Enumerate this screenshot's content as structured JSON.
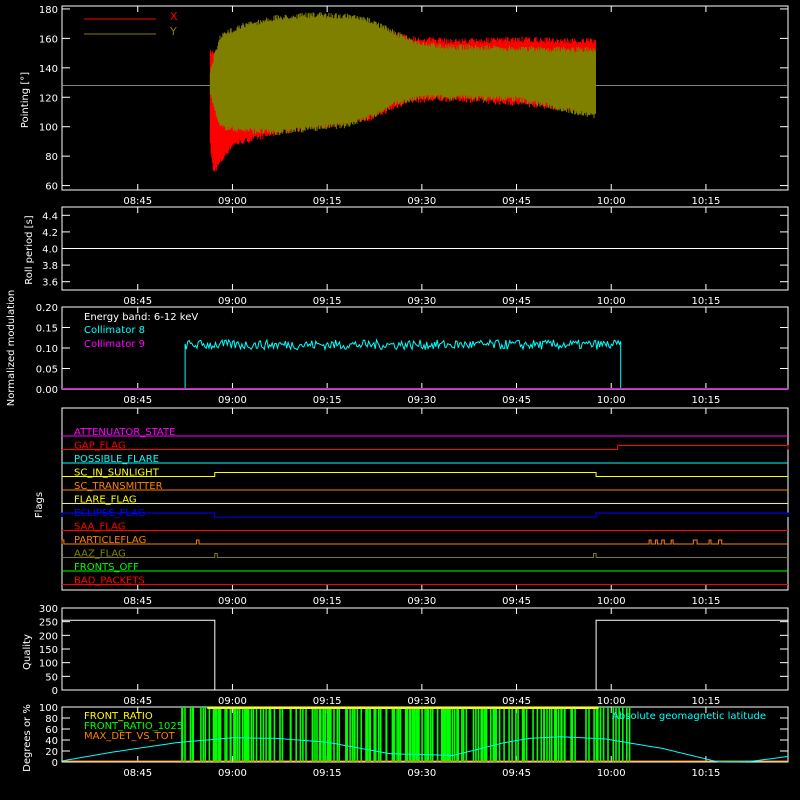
{
  "time_axis": {
    "tick_labels": [
      "08:45",
      "09:00",
      "09:15",
      "09:30",
      "09:45",
      "10:00",
      "10:15"
    ],
    "tick_minutes": [
      525,
      540,
      555,
      570,
      585,
      600,
      615
    ],
    "xlim_minutes": [
      513,
      628
    ]
  },
  "colors": {
    "axes": "#ffffff",
    "x_pointing": "#ff0000",
    "y_pointing": "#808000",
    "collimator_8": "#00ffff",
    "collimator_9": "#ff00ff",
    "front_ratio": "#ffff00",
    "front_ratio_1025": "#00ff00",
    "max_det_vs_tot": "#ff8000",
    "latitude": "#00ffff"
  },
  "chart_data": [
    {
      "type": "line",
      "ylabel": "Pointing [°]",
      "ylim": [
        57,
        182
      ],
      "yticks": [
        60,
        80,
        100,
        120,
        140,
        160,
        180
      ],
      "reference_line": 128,
      "series": [
        {
          "name": "X",
          "x_start": 536.5,
          "x_end": 597.5,
          "envelope_upper_x": [
            536.5,
            540,
            548,
            555,
            562,
            568,
            575,
            585,
            597.5
          ],
          "envelope_upper": [
            152,
            158,
            168,
            172,
            170,
            162,
            160,
            161,
            160
          ],
          "envelope_lower_x": [
            536.5,
            537,
            540,
            548,
            555,
            562,
            568,
            575,
            585,
            597.5
          ],
          "envelope_lower": [
            85,
            67,
            86,
            95,
            99,
            104,
            116,
            117,
            114,
            109
          ]
        },
        {
          "name": "Y",
          "x_start": 536.5,
          "x_end": 597.5,
          "envelope_upper_x": [
            536.5,
            538,
            541,
            547,
            553,
            558,
            562,
            566,
            570,
            575,
            585,
            597.5
          ],
          "envelope_upper": [
            140,
            163,
            170,
            176,
            178,
            177,
            174,
            165,
            158,
            156,
            155,
            154
          ],
          "envelope_lower_x": [
            536.5,
            538,
            541,
            547,
            553,
            558,
            562,
            566,
            570,
            575,
            585,
            597.5
          ],
          "envelope_lower": [
            120,
            98,
            96,
            94,
            97,
            99,
            105,
            114,
            118,
            118,
            117,
            105
          ]
        }
      ]
    },
    {
      "type": "line",
      "ylabel": "Roll period [s]",
      "ylim": [
        3.5,
        4.5
      ],
      "yticks": [
        3.6,
        3.8,
        4.0,
        4.2,
        4.4
      ],
      "series": [
        {
          "name": "",
          "x": [
            513,
            628
          ],
          "y": [
            4.0,
            4.0
          ]
        }
      ]
    },
    {
      "type": "line",
      "ylabel": "Normalized modulation",
      "ylim": [
        0,
        0.2
      ],
      "yticks": [
        0.0,
        0.05,
        0.1,
        0.15,
        0.2
      ],
      "annotation": "Energy band: 6-12 keV",
      "series": [
        {
          "name": "Collimator 8",
          "x_start": 532.5,
          "x_end": 601.5,
          "mean": 0.108,
          "spread": 0.012
        },
        {
          "name": "Collimator 9",
          "x": [
            513,
            628
          ],
          "y": [
            0.0,
            0.0
          ]
        }
      ]
    },
    {
      "type": "line",
      "ylabel": "Flags",
      "flags": [
        {
          "name": "ATTENUATOR_STATE",
          "color": "#ff00ff",
          "on": []
        },
        {
          "name": "GAP_FLAG",
          "color": "#ff0000",
          "on": [
            [
              601,
              628
            ]
          ]
        },
        {
          "name": "POSSIBLE_FLARE",
          "color": "#00ffff",
          "on": []
        },
        {
          "name": "SC_IN_SUNLIGHT",
          "color": "#ffff00",
          "on": [
            [
              537.2,
              597.6
            ]
          ]
        },
        {
          "name": "SC_TRANSMITTER",
          "color": "#ff8000",
          "on": []
        },
        {
          "name": "FLARE_FLAG",
          "color": "#ffff00",
          "on": []
        },
        {
          "name": "ECLIPSE_FLAG",
          "color": "#0000ff",
          "on": [
            [
              513,
              537.2
            ],
            [
              597.6,
              628
            ]
          ]
        },
        {
          "name": "SAA_FLAG",
          "color": "#ff0000",
          "on": []
        },
        {
          "name": "PARTICLEFLAG",
          "color": "#ff8000",
          "on": [
            [
              513,
              513.3
            ],
            [
              534.3,
              534.7
            ],
            [
              606,
              606.3
            ],
            [
              607,
              607.3
            ],
            [
              608,
              608.4
            ],
            [
              609.5,
              609.8
            ],
            [
              613,
              613.6
            ],
            [
              615.5,
              615.8
            ],
            [
              617,
              617.5
            ]
          ]
        },
        {
          "name": "AAZ_FLAG",
          "color": "#808000",
          "on": [
            [
              537.2,
              537.6
            ],
            [
              597.2,
              597.6
            ]
          ]
        },
        {
          "name": "FRONTS_OFF",
          "color": "#00ff00",
          "on": []
        },
        {
          "name": "BAD_PACKETS",
          "color": "#ff0000",
          "on": []
        }
      ]
    },
    {
      "type": "line",
      "ylabel": "Quality",
      "ylim": [
        0,
        300
      ],
      "yticks": [
        0,
        50,
        100,
        150,
        200,
        250,
        300
      ],
      "series": [
        {
          "name": "",
          "x": [
            513,
            537.2,
            537.2,
            597.6,
            597.6,
            628
          ],
          "y": [
            255,
            255,
            0,
            0,
            255,
            255
          ]
        }
      ]
    },
    {
      "type": "line",
      "ylabel": "Degrees or %",
      "ylim": [
        0,
        100
      ],
      "yticks": [
        0,
        20,
        40,
        60,
        80,
        100
      ],
      "series": [
        {
          "name": "FRONT_RATIO",
          "x_start": 536,
          "x_end": 598,
          "y": 100
        },
        {
          "name": "FRONT_RATIO_1025",
          "x_start": 532,
          "x_end": 603,
          "y_low": 0,
          "y_high": 100
        },
        {
          "name": "MAX_DET_VS_TOT",
          "x": [
            513,
            628
          ],
          "y": [
            0,
            0
          ]
        },
        {
          "name": "Absolute geomagnetic latitude",
          "x": [
            513,
            521,
            531,
            540,
            547,
            555,
            565,
            575,
            583,
            587,
            592,
            599,
            608,
            617,
            622,
            628
          ],
          "y": [
            2,
            18,
            35,
            44,
            43,
            36,
            15,
            12,
            35,
            43,
            46,
            42,
            25,
            0,
            1,
            10
          ]
        }
      ]
    }
  ]
}
